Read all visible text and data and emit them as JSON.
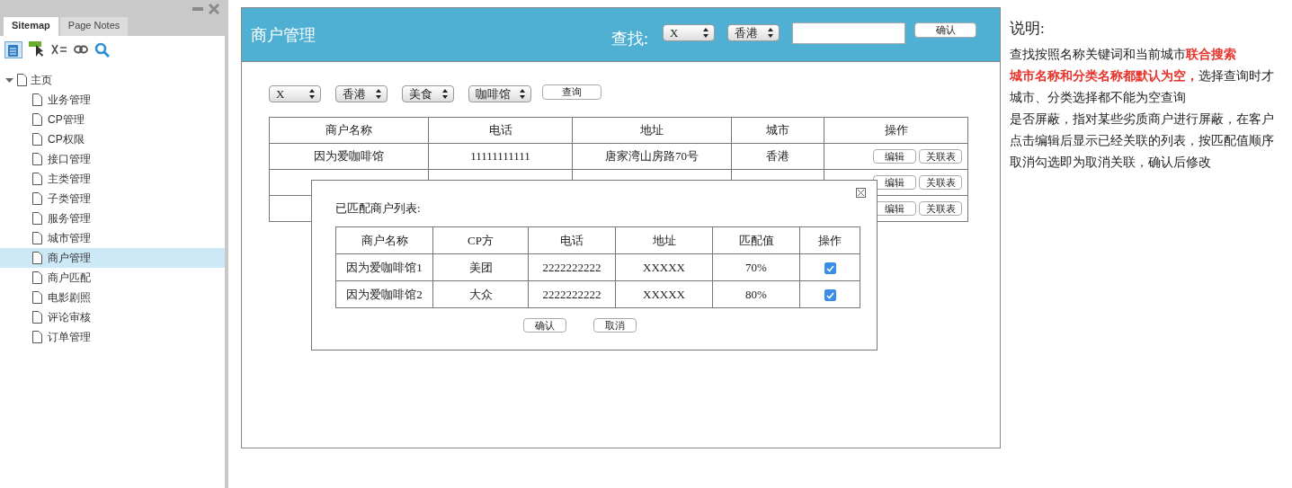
{
  "sidebar": {
    "tabs": [
      {
        "label": "Sitemap",
        "selected": true
      },
      {
        "label": "Page Notes",
        "selected": false
      }
    ],
    "tree": [
      {
        "label": "主页",
        "expanded": true,
        "selected": false,
        "children": [
          {
            "label": "业务管理",
            "selected": false
          },
          {
            "label": "CP管理",
            "selected": false
          },
          {
            "label": "CP权限",
            "selected": false
          },
          {
            "label": "接口管理",
            "selected": false
          },
          {
            "label": "主类管理",
            "selected": false
          },
          {
            "label": "子类管理",
            "selected": false
          },
          {
            "label": "服务管理",
            "selected": false
          },
          {
            "label": "城市管理",
            "selected": false
          },
          {
            "label": "商户管理",
            "selected": true
          },
          {
            "label": "商户匹配",
            "selected": false
          },
          {
            "label": "电影剧照",
            "selected": false
          },
          {
            "label": "评论审核",
            "selected": false
          },
          {
            "label": "订单管理",
            "selected": false
          }
        ]
      }
    ]
  },
  "page": {
    "title": "商户管理",
    "search": {
      "label": "查找:",
      "selects": [
        "X",
        "香港"
      ],
      "button": "确认"
    },
    "filters": {
      "selects": [
        "X",
        "香港",
        "美食",
        "咖啡馆"
      ],
      "button": "查询"
    },
    "table": {
      "columns": [
        "商户名称",
        "电话",
        "地址",
        "城市",
        "操作"
      ],
      "rows": [
        {
          "cells": [
            "因为爱咖啡馆",
            "11111111111",
            "唐家湾山房路70号",
            "香港"
          ],
          "actions": [
            "编辑",
            "关联表"
          ]
        },
        {
          "actions": [
            "编辑",
            "关联表"
          ]
        },
        {
          "actions": [
            "编辑",
            "关联表"
          ]
        }
      ]
    },
    "dialog": {
      "title": "已匹配商户列表:",
      "columns": [
        "商户名称",
        "CP方",
        "电话",
        "地址",
        "匹配值",
        "操作"
      ],
      "rows": [
        {
          "cells": [
            "因为爱咖啡馆1",
            "美团",
            "2222222222",
            "XXXXX",
            "70%"
          ],
          "checked": true
        },
        {
          "cells": [
            "因为爱咖啡馆2",
            "大众",
            "2222222222",
            "XXXXX",
            "80%"
          ],
          "checked": true
        }
      ],
      "buttons": [
        "确认",
        "取消"
      ]
    }
  },
  "notes": {
    "title": "说明:",
    "lines": [
      {
        "segments": [
          {
            "text": "查找按照名称关键词和当前城市",
            "highlight": false
          },
          {
            "text": "联合搜索",
            "highlight": true
          }
        ]
      },
      {
        "segments": [
          {
            "text": "城市名称和分类名称都默认为空，",
            "highlight": true
          },
          {
            "text": "选择查询时才",
            "highlight": false
          }
        ]
      },
      {
        "segments": [
          {
            "text": "城市、分类选择都不能为空查询",
            "highlight": false
          }
        ]
      },
      {
        "segments": [
          {
            "text": "是否屏蔽，指对某些劣质商户进行屏蔽，在客户",
            "highlight": false
          }
        ]
      },
      {
        "segments": [
          {
            "text": "点击编辑后显示已经关联的列表，按匹配值顺序",
            "highlight": false
          }
        ]
      },
      {
        "segments": [
          {
            "text": "取消勾选即为取消关联，确认后修改",
            "highlight": false
          }
        ]
      }
    ]
  }
}
